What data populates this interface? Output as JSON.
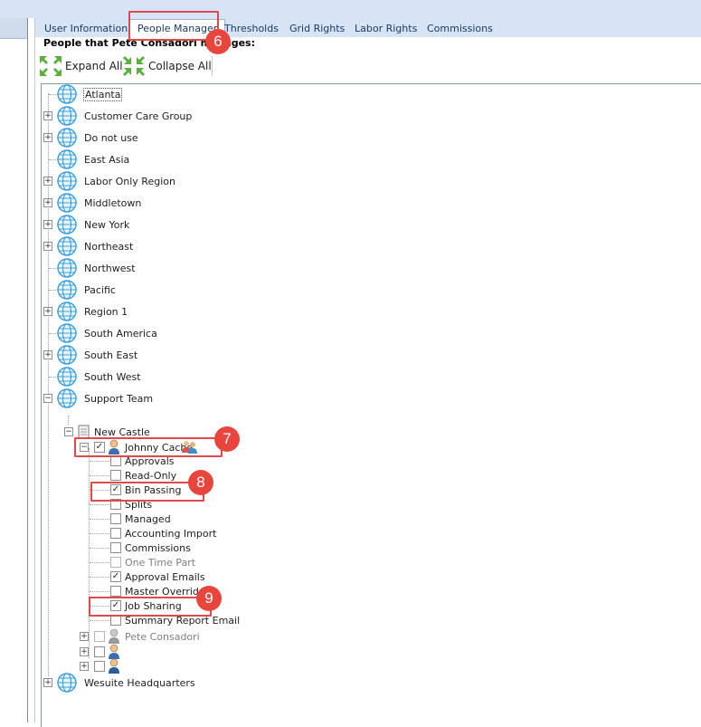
{
  "tabs": [
    {
      "label": "User Information"
    },
    {
      "label": "People Manager"
    },
    {
      "label": "Thresholds"
    },
    {
      "label": "Grid Rights"
    },
    {
      "label": "Labor Rights"
    },
    {
      "label": "Commissions"
    }
  ],
  "active_tab": "People Manager",
  "header": {
    "title": "People that Pete Consadori manages:"
  },
  "toolbar": {
    "expand_label": "Expand All",
    "collapse_label": "Collapse All"
  },
  "regions": [
    {
      "label": "Atlanta",
      "expandable": false
    },
    {
      "label": "Customer Care Group",
      "expandable": true
    },
    {
      "label": "Do not use",
      "expandable": true
    },
    {
      "label": "East Asia",
      "expandable": false
    },
    {
      "label": "Labor Only Region",
      "expandable": true
    },
    {
      "label": "Middletown",
      "expandable": true
    },
    {
      "label": "New York",
      "expandable": true
    },
    {
      "label": "Northeast",
      "expandable": true
    },
    {
      "label": "Northwest",
      "expandable": false
    },
    {
      "label": "Pacific",
      "expandable": false
    },
    {
      "label": "Region 1",
      "expandable": true
    },
    {
      "label": "South America",
      "expandable": false
    },
    {
      "label": "South East",
      "expandable": true
    },
    {
      "label": "South West",
      "expandable": false
    },
    {
      "label": "Support Team",
      "expandable": true,
      "expanded": true
    }
  ],
  "store": {
    "label": "New Castle"
  },
  "person": {
    "label": "Johnny Cache",
    "checked": true
  },
  "permissions": [
    {
      "label": "Approvals",
      "checked": false
    },
    {
      "label": "Read-Only",
      "checked": false
    },
    {
      "label": "Bin Passing",
      "checked": true
    },
    {
      "label": "Splits",
      "checked": false
    },
    {
      "label": "Managed",
      "checked": false
    },
    {
      "label": "Accounting Import",
      "checked": false
    },
    {
      "label": "Commissions",
      "checked": false
    },
    {
      "label": "One Time Part",
      "checked": false,
      "disabled": true
    },
    {
      "label": "Approval Emails",
      "checked": true
    },
    {
      "label": "Master Override",
      "checked": false
    },
    {
      "label": "Job Sharing",
      "checked": true
    },
    {
      "label": "Summary Report Email",
      "checked": false
    }
  ],
  "other_people": [
    {
      "label": "Pete Consadori",
      "checked": false,
      "disabled": true
    },
    {
      "label": "",
      "checked": false
    },
    {
      "label": "",
      "checked": false
    }
  ],
  "last_region": {
    "label": "Wesuite Headquarters",
    "expandable": true
  },
  "callouts": [
    "6",
    "7",
    "8",
    "9"
  ],
  "colors": {
    "tabstrip": "#d6e4f5",
    "callout": "#e8453c",
    "highlight_box": "#e04a4a"
  }
}
